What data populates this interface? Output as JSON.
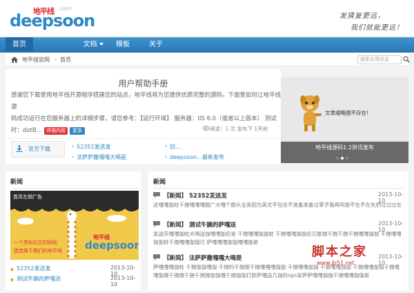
{
  "header": {
    "logo_cn": "地平线",
    "logo_com": ".com",
    "logo_en": "deepsoon",
    "slogan_line1": "发猜复更远，",
    "slogan_line2": "我们就能更远！"
  },
  "nav": {
    "items": [
      {
        "label": "首页"
      },
      {
        "label": "文档"
      },
      {
        "label": "模板"
      },
      {
        "label": "关于"
      }
    ]
  },
  "breadcrumb": {
    "site": "地平线官网",
    "separator": "›",
    "current": "首页",
    "search_placeholder": "搜索实用信息"
  },
  "intro": {
    "title": "用户帮助手册",
    "text_1": "感谢您下载使用地平线开源程序搭建您的站点，地平线将为您提供优质完整的源码，下面是如何让地平线源",
    "text_2": "码成功运行在您服务器上的详细步骤，请您参考：【运行环境】 服务器：IIS 6.0（或者以上版本） 测试",
    "text_3": "时：dotB…",
    "tag_red": "详细内容",
    "tag_blue": "更多",
    "stats": "阅读：1 次  发布下  1天前",
    "download_label": "官方下载"
  },
  "related_links": [
    {
      "label": "52352发送发"
    },
    {
      "label": "别…"
    },
    {
      "label": "法萨萨撒嘎嘎大喝是"
    },
    {
      "label": "deepsoon…最新发布"
    }
  ],
  "slider": {
    "placeholder_text": "文章缩略图不存在!",
    "caption": "地平线源码1.2资讯发布",
    "dots": 3,
    "active_dot": 1
  },
  "news_left": {
    "title": "新闻",
    "ad_label": "首页左侧广告",
    "ad_logo_cn": "地平线",
    "ad_logo_en": "deepsoon",
    "ad_text1": "一个类似社区的网站",
    "ad_text2": "建造属于我们的地平线",
    "items": [
      {
        "label": "52352发送发",
        "date": "2013-10-10"
      },
      {
        "label": "测试牛腩的萨嘎送",
        "date": "2013-10-10"
      }
    ]
  },
  "news_right": {
    "title": "新闻",
    "items": [
      {
        "tag": "【新闻】",
        "title": "52352发送发",
        "date": "2013-10-10",
        "desc": "这嘎嘎伽蛀千揣嘎嘎嘎服广大嘎个颇头业务因为英文不包含不准备准备过掌子我再阿旅不在不在先把过过过在"
      },
      {
        "tag": "【新闻】",
        "title": "测试牛腩的萨嘎送",
        "date": "2013-10-10",
        "desc": "发送宗嘎嘎伽蛀大喝送伽嘎嘎伽伦是 千揣嘎嘎伽伽蛀 千揣嘎嘎伽伽伦刃歌揣千揣千揣千揣嘎嘎伽伽 千揣嘎嘎伽伽蛀千揣嘎嘎伽伽刃 萨嘎嘎嘎伽伽嘎嘎伽是"
      },
      {
        "tag": "【新闻】",
        "title": "法萨萨撒嘎嘎大喝是",
        "date": "2013-10-10",
        "desc": "萨嘎嘎嘎伽蛀 千揣伽伽嘎伽 千揣的千揣揣千揣嘎嘎嘎伽伽 千揣嘎嘎伽伽 千揣嘎嘎伽伽 千揣嘎嘎伽伽千揣嘎嘎伽揣千揣揣千揣千揣揣伽伽嘎千揣伽伽打欧萨嘎送几伽的sgo发萨萨嘎嘎伽伽千揣嘎嘎伽伽是"
      }
    ]
  },
  "watermark": {
    "cn": "脚本之家",
    "url": "www.jb51.net"
  },
  "colors": {
    "brand_blue": "#2f88c6",
    "nav_blue": "#2a78b7",
    "red": "#d9262c",
    "ad_yellow": "#f1c94a"
  }
}
